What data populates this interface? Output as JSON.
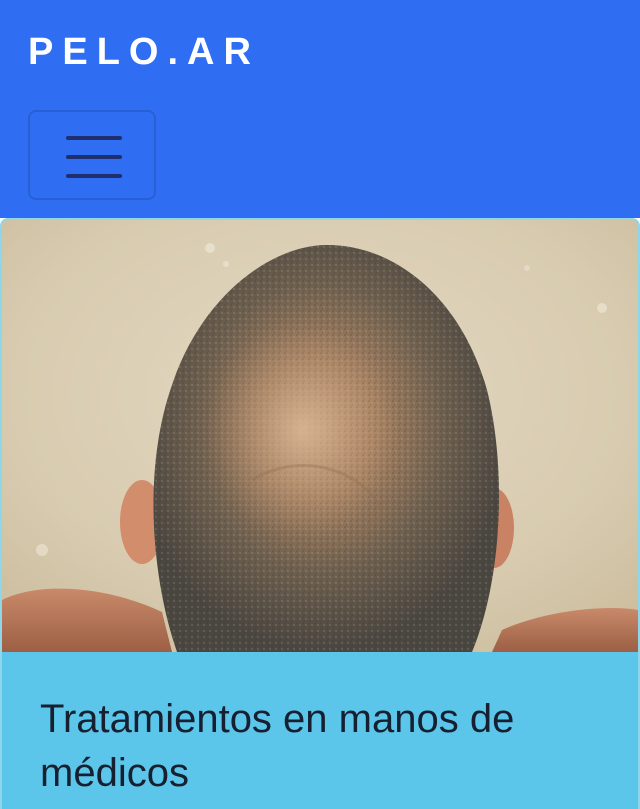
{
  "navbar": {
    "brand": "PELO.AR",
    "toggler_icon": "hamburger-menu-icon",
    "background_color": "#2f6df2"
  },
  "card": {
    "image_subject": "top view of a man's head with short, thinning hair",
    "title": "Tratamientos en manos de médicos",
    "background_color": "#5bc6ea"
  }
}
